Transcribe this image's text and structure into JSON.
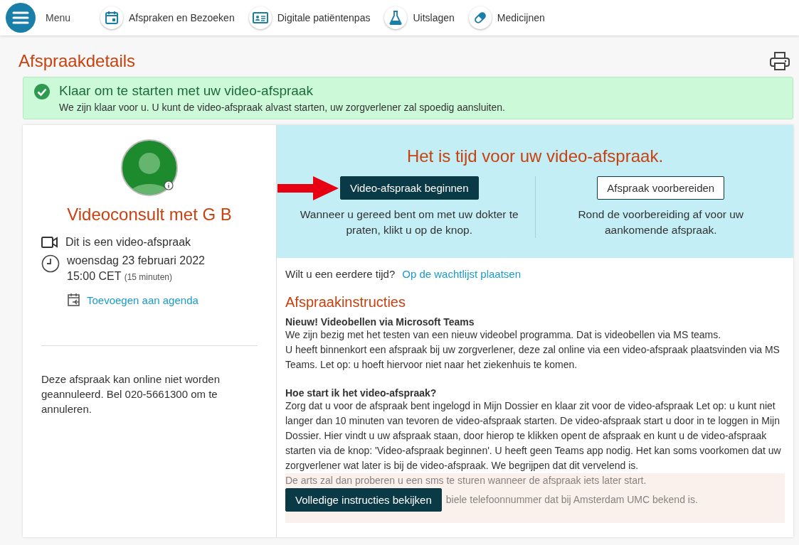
{
  "nav": {
    "menu_label": "Menu",
    "items": [
      {
        "label": "Afspraken en Bezoeken",
        "kind": "calendar"
      },
      {
        "label": "Digitale patiëntenpas",
        "kind": "card"
      },
      {
        "label": "Uitslagen",
        "kind": "flask"
      },
      {
        "label": "Medicijnen",
        "kind": "pills"
      }
    ]
  },
  "page_title": "Afspraakdetails",
  "alert": {
    "title": "Klaar om te starten met uw video-afspraak",
    "message": "We zijn klaar voor u. U kunt de video-afspraak alvast starten, uw zorgverlener zal spoedig aansluiten."
  },
  "appointment": {
    "title": "Videoconsult met G B",
    "video_note": "Dit is een video-afspraak",
    "date": "woensdag 23 februari 2022",
    "time": "15:00 CET",
    "duration": "(15 minuten)",
    "add_to_calendar": "Toevoegen aan agenda",
    "cancel_note": "Deze afspraak kan online niet worden geannuleerd. Bel 020-5661300 om te annuleren."
  },
  "video_panel": {
    "heading": "Het is tijd voor uw video-afspraak.",
    "actions": [
      {
        "label": "Video-afspraak beginnen",
        "kind": "primary",
        "description": "Wanneer u gereed bent om met uw dokter te praten, klikt u op de knop.",
        "highlighted": true
      },
      {
        "label": "Afspraak voorbereiden",
        "kind": "secondary",
        "description": "Rond de voorbereiding af voor uw aankomende afspraak.",
        "highlighted": false
      }
    ]
  },
  "waitlist": {
    "question": "Wilt u een eerdere tijd?",
    "link": "Op de wachtlijst plaatsen"
  },
  "instructions": {
    "heading": "Afspraakinstructies",
    "sections": [
      {
        "heading": "Nieuw! Videobellen via Microsoft Teams",
        "paragraphs": [
          "We zijn bezig met het testen van een nieuw videobel programma. Dat is videobellen via MS teams.",
          "U heeft binnenkort een afspraak bij uw zorgverlener, deze zal online via een video-afspraak plaatsvinden via MS Teams. Let op: u hoeft hiervoor niet naar het ziekenhuis te komen."
        ]
      },
      {
        "heading": "Hoe start ik het video-afspraak?",
        "paragraphs": [
          "Zorg dat u voor de afspraak bent ingelogd in Mijn Dossier en klaar zit voor de video-afspraak Let op: u kunt niet langer dan 10 minuten van tevoren de video-afspraak starten. De video-afspraak start u door in te loggen in Mijn Dossier. Hier vindt u uw afspraak staan, door hierop te klikken opent de afspraak en kunt u de video-afspraak starten via de knop: 'Video-afspraak beginnen'. U heeft geen Teams app nodig. Het kan soms voorkomen dat uw zorgverlener wat later is bij de video-afspraak. We begrijpen dat dit vervelend is."
        ]
      }
    ],
    "faded_lines": [
      "De arts zal dan proberen u een sms te sturen wanneer de afspraak iets later start.",
      "biele telefoonnummer dat bij Amsterdam UMC bekend is."
    ],
    "more_button": "Volledige instructies bekijken"
  }
}
